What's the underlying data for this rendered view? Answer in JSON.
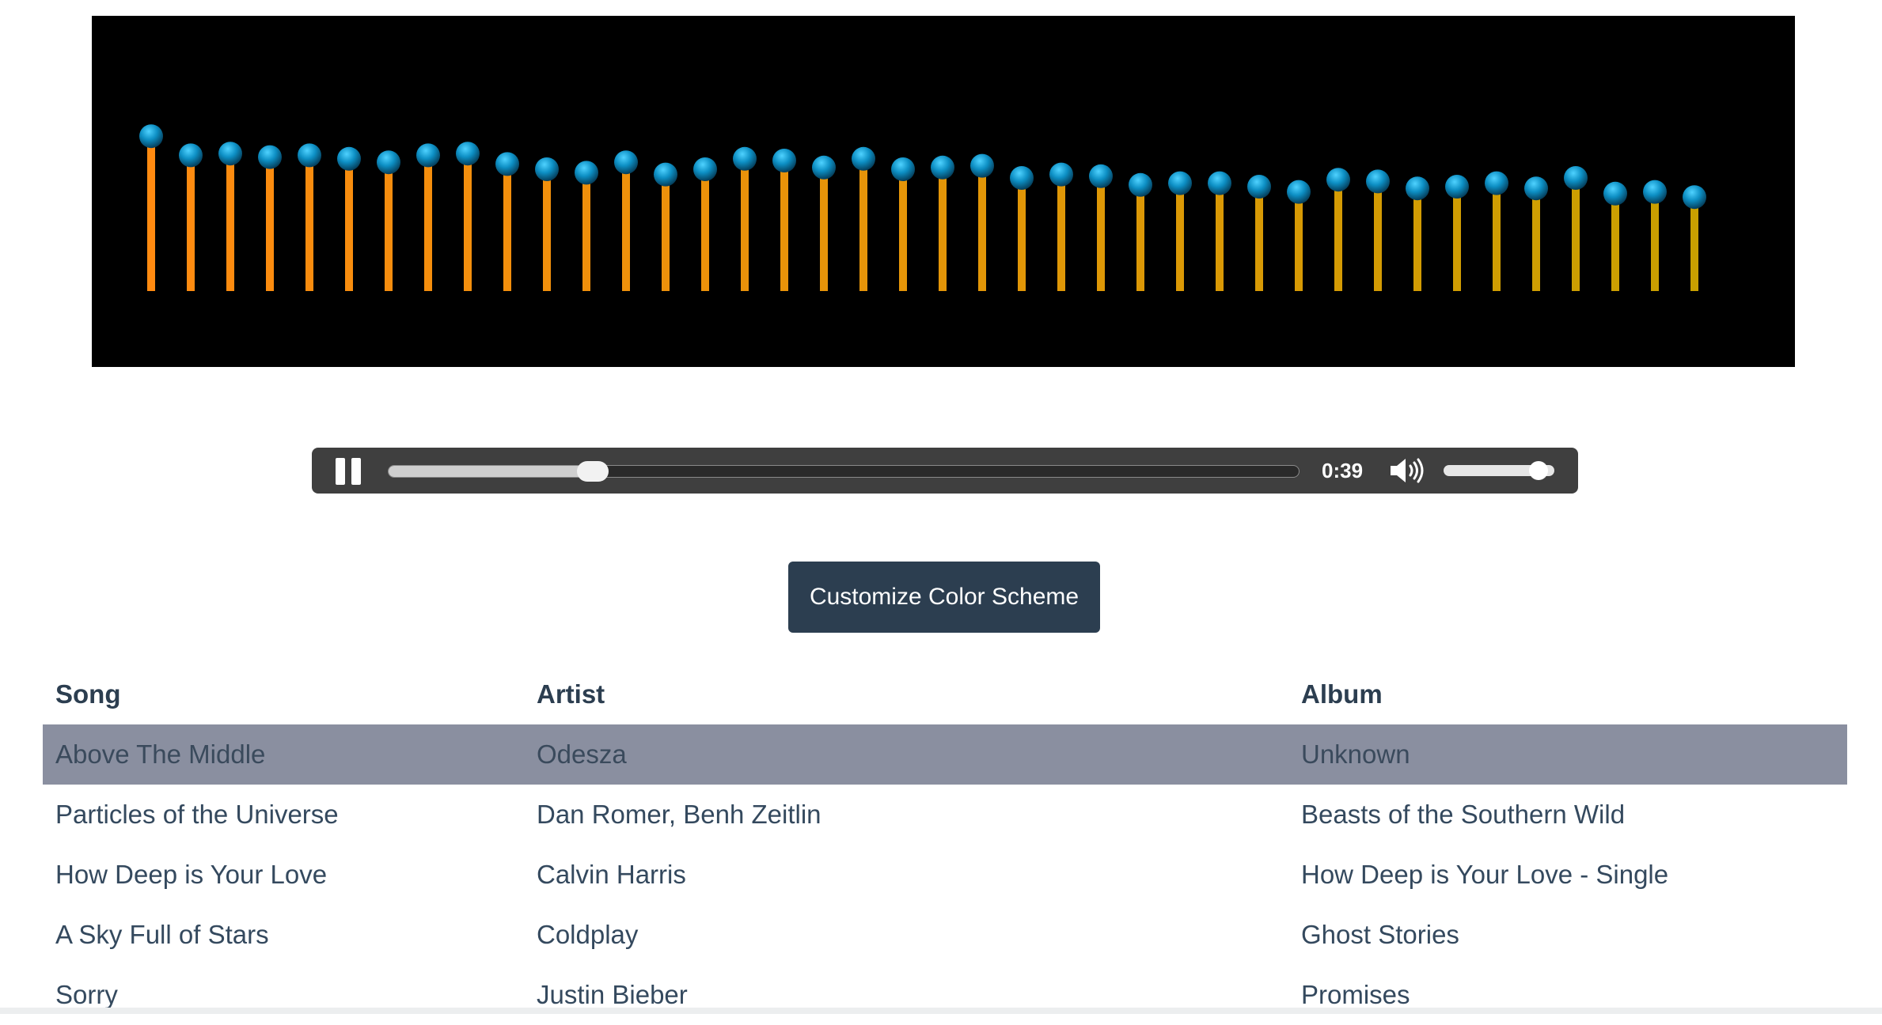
{
  "visualizer": {
    "bar_levels": [
      0.89,
      0.78,
      0.79,
      0.77,
      0.78,
      0.76,
      0.74,
      0.78,
      0.79,
      0.73,
      0.7,
      0.68,
      0.74,
      0.67,
      0.7,
      0.76,
      0.75,
      0.71,
      0.76,
      0.7,
      0.71,
      0.72,
      0.65,
      0.67,
      0.66,
      0.61,
      0.62,
      0.62,
      0.6,
      0.57,
      0.64,
      0.63,
      0.59,
      0.6,
      0.62,
      0.59,
      0.65,
      0.56,
      0.57,
      0.54
    ],
    "colors": {
      "bar_start": "#ff8a10",
      "bar_end": "#c9a000",
      "cap_light": "#1ec0ff",
      "cap_dark": "#0a6a90",
      "background": "#000000"
    }
  },
  "player": {
    "pause_icon": "pause-icon",
    "time": "0:39",
    "progress_fraction": 0.224,
    "volume_icon": "speaker-volume-icon",
    "volume_fraction": 0.86
  },
  "customize_button": {
    "label": "Customize Color Scheme"
  },
  "table": {
    "headers": {
      "song": "Song",
      "artist": "Artist",
      "album": "Album"
    },
    "rows": [
      {
        "song": "Above The Middle",
        "artist": "Odesza",
        "album": "Unknown",
        "active": true
      },
      {
        "song": "Particles of the Universe",
        "artist": "Dan Romer, Benh Zeitlin",
        "album": "Beasts of the Southern Wild",
        "active": false
      },
      {
        "song": "How Deep is Your Love",
        "artist": "Calvin Harris",
        "album": "How Deep is Your Love - Single",
        "active": false
      },
      {
        "song": "A Sky Full of Stars",
        "artist": "Coldplay",
        "album": "Ghost Stories",
        "active": false
      },
      {
        "song": "Sorry",
        "artist": "Justin Bieber",
        "album": "Promises",
        "active": false
      }
    ]
  }
}
